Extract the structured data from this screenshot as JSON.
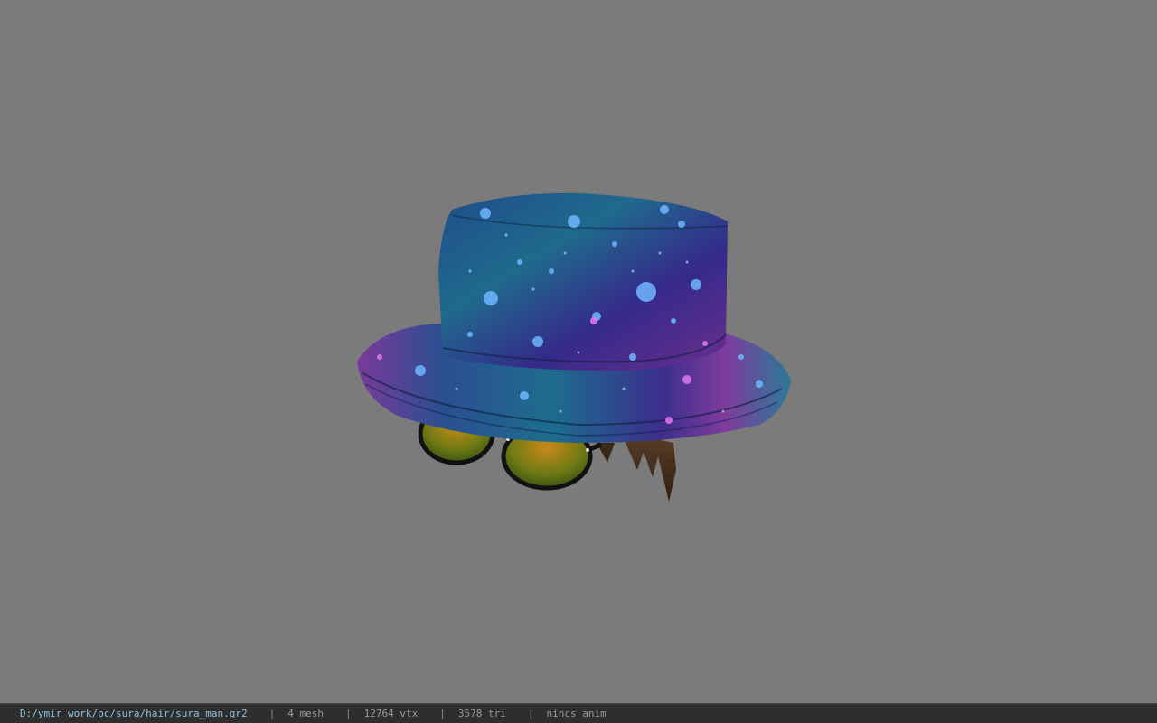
{
  "viewer": {
    "background_color": "#7b7b7b",
    "model_description_icon": "bucket-hat-with-sunglasses-and-hair-model"
  },
  "status": {
    "file_path": "D:/ymir work/pc/sura/hair/sura_man.gr2",
    "separator": "|",
    "mesh": "4 mesh",
    "vtx": "12764 vtx",
    "tri": "3578 tri",
    "anim": "nincs anim"
  },
  "colors": {
    "status_bg": "#2e2e2e",
    "path_text": "#8fc0e0",
    "info_text": "#9a9a9a"
  }
}
